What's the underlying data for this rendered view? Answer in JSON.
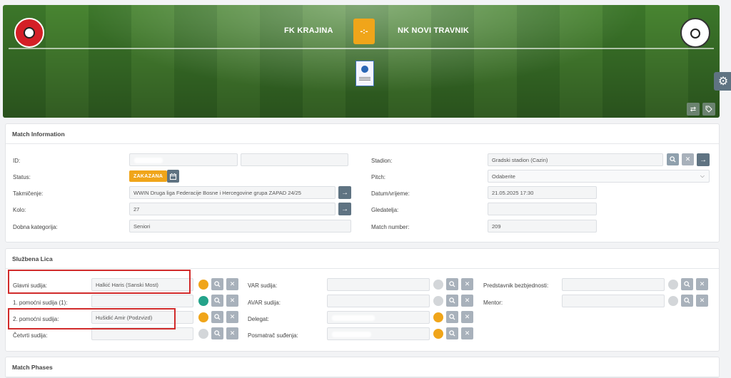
{
  "header": {
    "home_team": "FK KRAJINA",
    "away_team": "NK NOVI TRAVNIK",
    "vs_symbol": "-:-",
    "home_crest_icon": "fk-krajina-crest",
    "away_crest_icon": "nk-novi-travnik-crest",
    "league_icon": "league-badge",
    "swap_icon": "swap-icon",
    "tag_icon": "tag-icon"
  },
  "settings_icon": "gear-icon",
  "match_info": {
    "title": "Match Information",
    "id_label": "ID:",
    "status_label": "Status:",
    "status_value": "ZAKAZANA",
    "competition_label": "Takmičenje:",
    "competition_value": "WWIN Druga liga Federacije Bosne i Hercegovine grupa ZAPAD 24/25",
    "round_label": "Kolo:",
    "round_value": "27",
    "age_label": "Dobna kategorija:",
    "age_value": "Seniori",
    "stadium_label": "Stadion:",
    "stadium_value": "Gradski stadion (Cazin)",
    "pitch_label": "Pitch:",
    "pitch_value": "Odaberite",
    "datetime_label": "Datum/vrijeme:",
    "datetime_value": "21.05.2025 17:30",
    "spectators_label": "Gledatelja:",
    "spectators_value": "",
    "match_number_label": "Match number:",
    "match_number_value": "209"
  },
  "officials": {
    "title": "Službena Lica",
    "col1": [
      {
        "label": "Glavni sudija:",
        "value": "Halkić Haris (Sanski Most)",
        "status": "orange"
      },
      {
        "label": "1. pomoćni sudija (1):",
        "value": "",
        "status": "teal"
      },
      {
        "label": "2. pomoćni sudija:",
        "value": "Hušidić Amir (Podzvizd)",
        "status": "orange"
      },
      {
        "label": "Četvrti sudija:",
        "value": "",
        "status": "grey"
      }
    ],
    "col2": [
      {
        "label": "VAR sudija:",
        "value": "",
        "status": "grey"
      },
      {
        "label": "AVAR sudija:",
        "value": "",
        "status": "grey"
      },
      {
        "label": "Delegat:",
        "value": "",
        "status": "orange"
      },
      {
        "label": "Posmatrač suđenja:",
        "value": "",
        "status": "orange"
      }
    ],
    "col3": [
      {
        "label": "Predstavnik bezbjednosti:",
        "value": "",
        "status": "grey"
      },
      {
        "label": "Mentor:",
        "value": "",
        "status": "grey"
      }
    ]
  },
  "phases": {
    "title": "Match Phases"
  },
  "colors": {
    "accent_orange": "#f0a51a",
    "button_dark": "#5f7382",
    "highlight_red": "#d12b2b"
  }
}
